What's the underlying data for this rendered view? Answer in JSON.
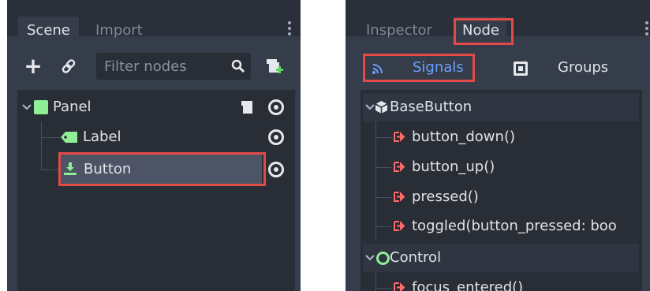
{
  "scene_dock": {
    "tabs": [
      "Scene",
      "Import"
    ],
    "filter_placeholder": "Filter nodes",
    "tree": [
      {
        "name": "Panel"
      },
      {
        "name": "Label"
      },
      {
        "name": "Button"
      }
    ]
  },
  "node_dock": {
    "tabs": [
      "Inspector",
      "Node"
    ],
    "subtabs": [
      "Signals",
      "Groups"
    ],
    "categories": [
      {
        "name": "BaseButton",
        "signals": [
          "button_down()",
          "button_up()",
          "pressed()",
          "toggled(button_pressed: boo"
        ]
      },
      {
        "name": "Control",
        "signals": [
          "focus_entered()"
        ]
      }
    ]
  },
  "colors": {
    "highlight": "#e24a48",
    "panel_bg": "#363d4a",
    "tree_bg": "#282d36",
    "accent_blue": "#6aa0ff",
    "signal_red": "#ff6b6b",
    "control_green": "#8eef97"
  }
}
